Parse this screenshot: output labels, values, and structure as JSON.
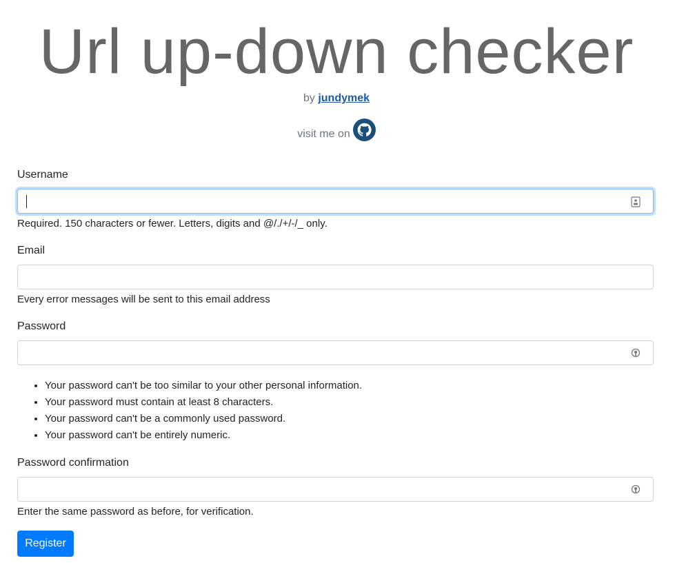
{
  "header": {
    "title": "Url up-down checker",
    "by_prefix": "by",
    "author_link": "jundymek",
    "visit_text": "visit me on"
  },
  "form": {
    "username": {
      "label": "Username",
      "value": "",
      "help": "Required. 150 characters or fewer. Letters, digits and @/./+/-/_ only."
    },
    "email": {
      "label": "Email",
      "value": "",
      "help": "Every error messages will be sent to this email address"
    },
    "password": {
      "label": "Password",
      "value": "",
      "rules": [
        "Your password can't be too similar to your other personal information.",
        "Your password must contain at least 8 characters.",
        "Your password can't be a commonly used password.",
        "Your password can't be entirely numeric."
      ]
    },
    "password_confirmation": {
      "label": "Password confirmation",
      "value": "",
      "help": "Enter the same password as before, for verification."
    },
    "submit_label": "Register"
  },
  "colors": {
    "primary": "#007bff",
    "link": "#1e5aa8",
    "github_icon": "#1b4f7a",
    "muted": "#6c757d"
  },
  "icons": {
    "github": "github-icon",
    "username_autofill": "contact-card-icon",
    "password_reveal": "key-icon"
  }
}
